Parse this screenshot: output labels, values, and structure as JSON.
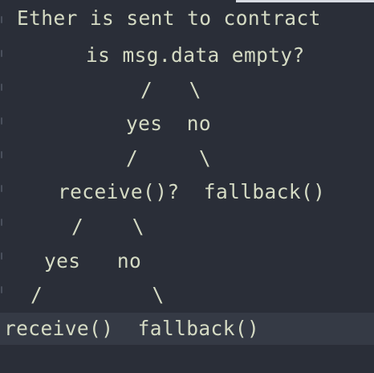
{
  "editor": {
    "lines": [
      "Ether is sent to contract",
      "is msg.data empty?",
      "/   \\",
      "yes  no",
      "/     \\",
      "receive()?  fallback()",
      "/    \\",
      "yes   no",
      "/         \\",
      "receive()  fallback()"
    ],
    "highlighted_line": 10
  },
  "colors": {
    "background": "#2a2e38",
    "text": "#d5dbc4",
    "current_line_highlight": "#353a45"
  }
}
